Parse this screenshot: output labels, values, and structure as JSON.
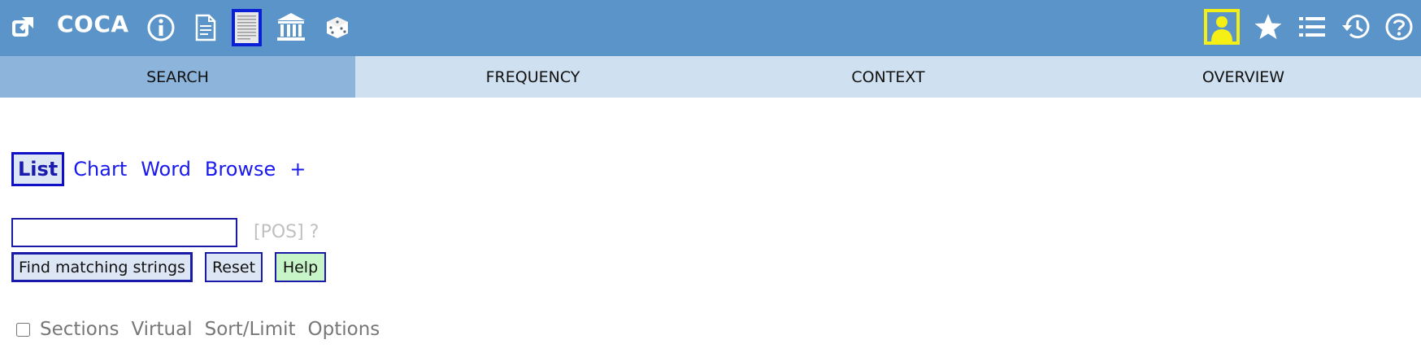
{
  "header": {
    "app_title": "COCA",
    "icons": [
      "external-link-icon",
      "info-icon",
      "document-icon",
      "text-page-icon",
      "museum-icon",
      "dice-icon",
      "user-account-icon",
      "star-icon",
      "list-icon",
      "history-icon",
      "help-icon"
    ],
    "colors": {
      "bar": "#5b94c9",
      "highlight_blue": "#0b1fd6",
      "highlight_yellow": "#f5ef16"
    }
  },
  "tabs": [
    {
      "label": "SEARCH",
      "active": true
    },
    {
      "label": "FREQUENCY"
    },
    {
      "label": "CONTEXT"
    },
    {
      "label": "OVERVIEW"
    }
  ],
  "subnav": {
    "items": [
      "List",
      "Chart",
      "Word",
      "Browse",
      "+"
    ],
    "active": "List"
  },
  "search": {
    "input_value": "",
    "pos_hint": "[POS] ?",
    "find_label": "Find matching strings",
    "reset_label": "Reset",
    "help_label": "Help"
  },
  "options": {
    "sections_checked": false,
    "items": [
      "Sections",
      "Virtual",
      "Sort/Limit",
      "Options"
    ]
  }
}
